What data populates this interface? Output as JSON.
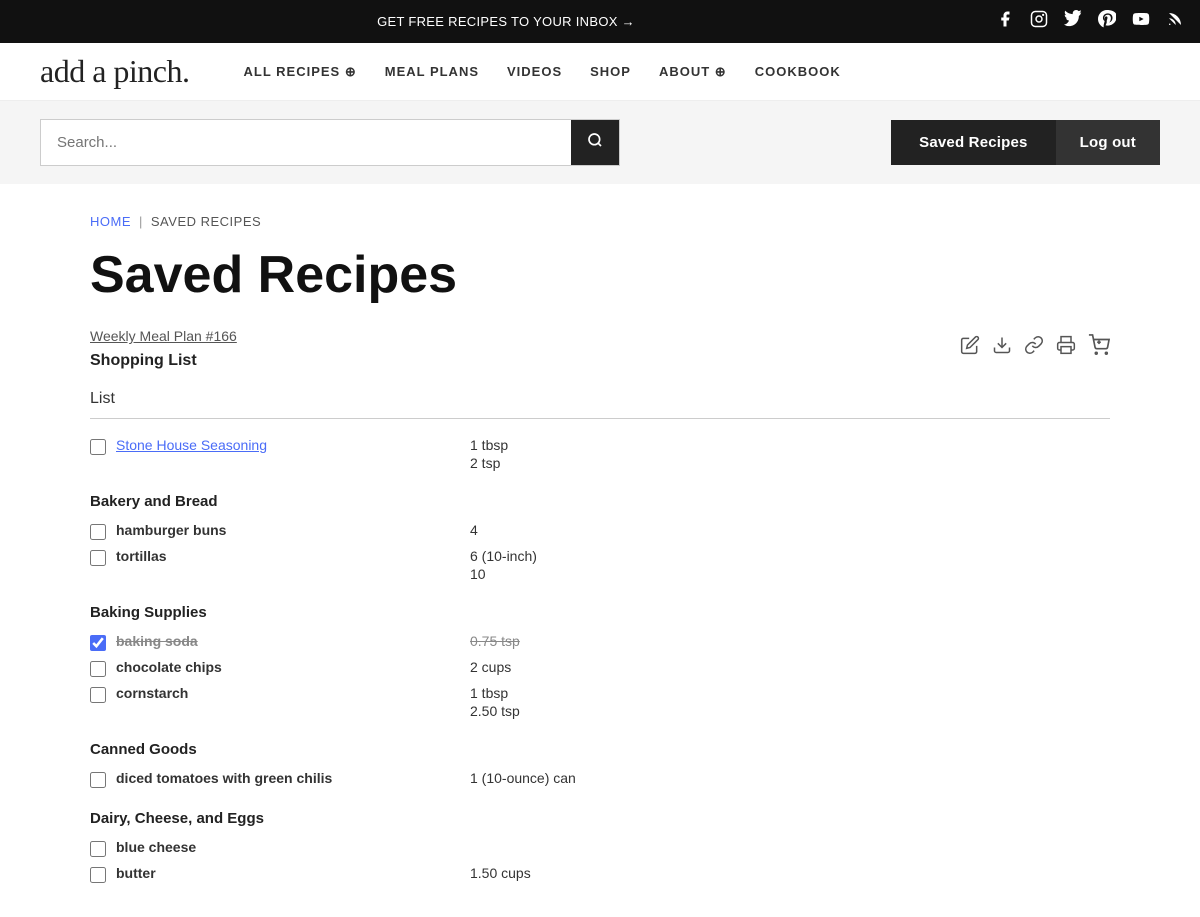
{
  "banner": {
    "cta": "GET FREE RECIPES TO YOUR INBOX →",
    "social": [
      "facebook",
      "instagram",
      "twitter",
      "pinterest",
      "youtube",
      "rss"
    ]
  },
  "nav": {
    "logo": "add a pinch.",
    "items": [
      {
        "label": "ALL RECIPES ⊕",
        "id": "all-recipes"
      },
      {
        "label": "MEAL PLANS",
        "id": "meal-plans"
      },
      {
        "label": "VIDEOS",
        "id": "videos"
      },
      {
        "label": "SHOP",
        "id": "shop"
      },
      {
        "label": "ABOUT ⊕",
        "id": "about"
      },
      {
        "label": "COOKBOOK",
        "id": "cookbook"
      }
    ]
  },
  "search": {
    "placeholder": "Search...",
    "button_label": "🔍"
  },
  "header_buttons": {
    "saved_recipes": "Saved Recipes",
    "logout": "Log out"
  },
  "breadcrumb": {
    "home": "HOME",
    "separator": "|",
    "current": "SAVED RECIPES"
  },
  "page": {
    "title": "Saved Recipes",
    "meal_plan_link": "Weekly Meal Plan #166",
    "shopping_list_label": "Shopping List",
    "list_section": "List"
  },
  "tool_icons": [
    "✏️",
    "⬇",
    "🔗",
    "🖨",
    "🛒"
  ],
  "shopping_list": [
    {
      "type": "item",
      "checked": false,
      "label": "Stone House Seasoning",
      "is_link": true,
      "amounts": [
        "1 tbsp",
        "2 tsp"
      ]
    },
    {
      "type": "category",
      "label": "Bakery and Bread"
    },
    {
      "type": "item",
      "checked": false,
      "label": "hamburger buns",
      "is_link": false,
      "bold": true,
      "amounts": [
        "4"
      ]
    },
    {
      "type": "item",
      "checked": false,
      "label": "tortillas",
      "is_link": false,
      "bold": true,
      "amounts": [
        "6 (10-inch)",
        "10"
      ]
    },
    {
      "type": "category",
      "label": "Baking Supplies"
    },
    {
      "type": "item",
      "checked": true,
      "label": "baking soda",
      "is_link": false,
      "bold": true,
      "strikethrough": true,
      "amounts": [
        "0.75 tsp"
      ]
    },
    {
      "type": "item",
      "checked": false,
      "label": "chocolate chips",
      "is_link": false,
      "bold": true,
      "amounts": [
        "2 cups"
      ]
    },
    {
      "type": "item",
      "checked": false,
      "label": "cornstarch",
      "is_link": false,
      "bold": true,
      "amounts": [
        "1 tbsp",
        "2.50 tsp"
      ]
    },
    {
      "type": "category",
      "label": "Canned Goods"
    },
    {
      "type": "item",
      "checked": false,
      "label": "diced tomatoes with green chilis",
      "is_link": false,
      "bold": true,
      "amounts": [
        "1 (10-ounce) can"
      ]
    },
    {
      "type": "category",
      "label": "Dairy, Cheese, and Eggs"
    },
    {
      "type": "item",
      "checked": false,
      "label": "blue cheese",
      "is_link": false,
      "bold": true,
      "amounts": []
    },
    {
      "type": "item",
      "checked": false,
      "label": "butter",
      "is_link": false,
      "bold": true,
      "amounts": [
        "1.50 cups"
      ]
    }
  ]
}
